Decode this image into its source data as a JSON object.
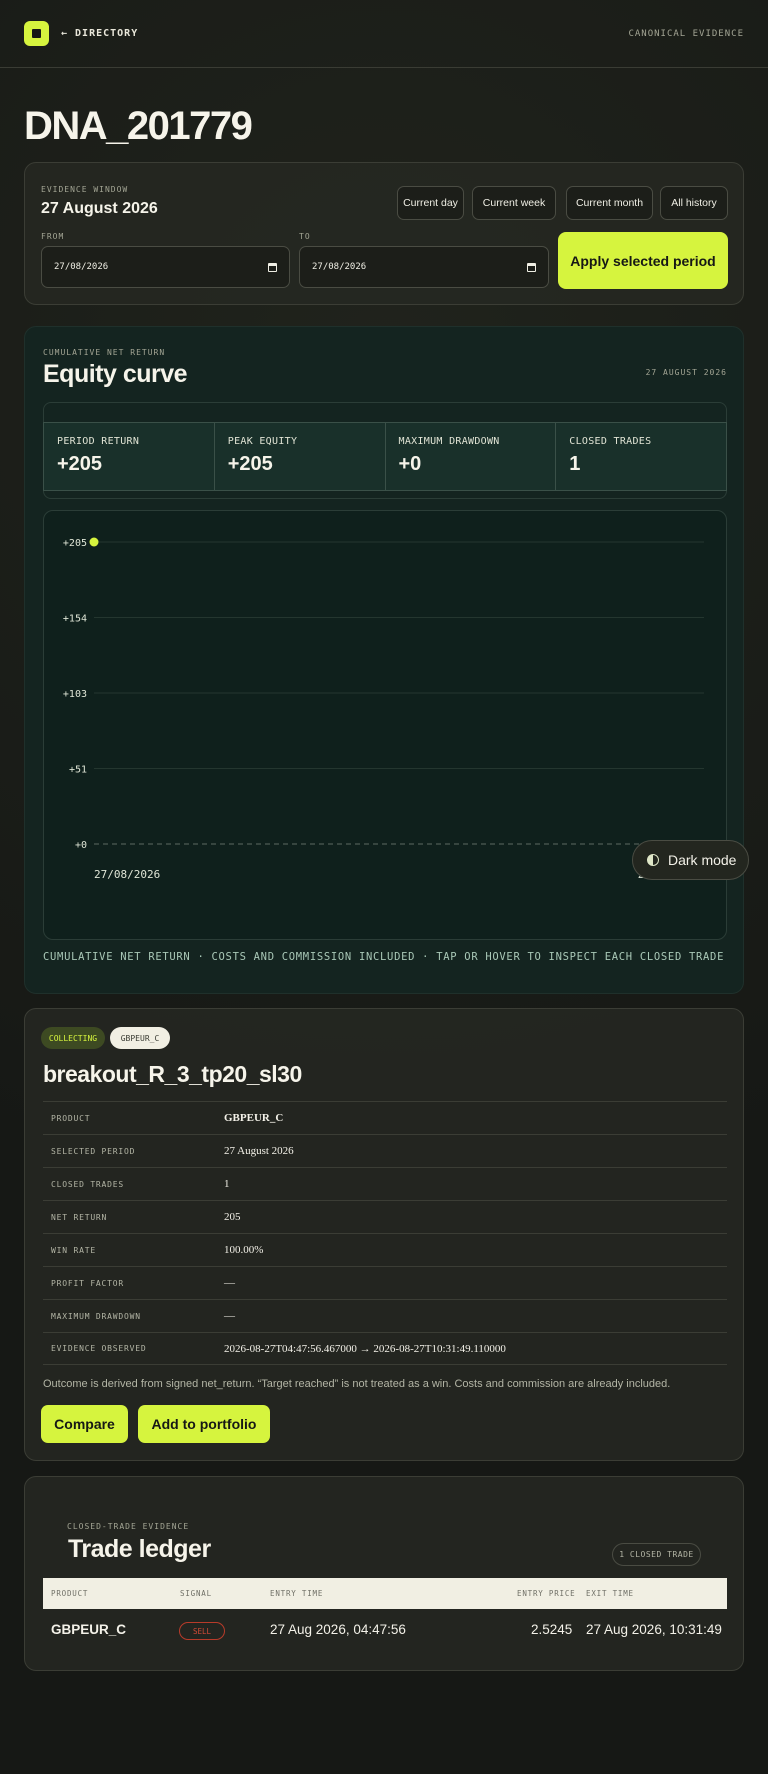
{
  "header": {
    "back_label": "← DIRECTORY",
    "right_label": "CANONICAL EVIDENCE"
  },
  "page": {
    "title": "DNA_201779"
  },
  "evidence_window": {
    "kicker": "EVIDENCE WINDOW",
    "date": "27 August 2026",
    "quick_ranges": [
      "Current day",
      "Current week",
      "Current month",
      "All history"
    ],
    "from_label": "FROM",
    "to_label": "TO",
    "from_value": "27/08/2026",
    "to_value": "27/08/2026",
    "apply_label": "Apply selected period"
  },
  "equity": {
    "kicker": "CUMULATIVE NET RETURN",
    "title": "Equity curve",
    "date": "27 AUGUST 2026",
    "stats": [
      {
        "label": "PERIOD RETURN",
        "value": "+205"
      },
      {
        "label": "PEAK EQUITY",
        "value": "+205"
      },
      {
        "label": "MAXIMUM DRAWDOWN",
        "value": "+0"
      },
      {
        "label": "CLOSED TRADES",
        "value": "1"
      }
    ],
    "caption": "CUMULATIVE NET RETURN · COSTS AND COMMISSION INCLUDED · TAP OR HOVER TO INSPECT EACH CLOSED TRADE"
  },
  "chart_data": {
    "type": "line",
    "x": [
      "27/08/2026"
    ],
    "series": [
      {
        "values": [
          205
        ]
      }
    ],
    "yticks": [
      "+205",
      "+154",
      "+103",
      "+51",
      "+0"
    ],
    "xticks": [
      "27/08/2026",
      "27/08/2026"
    ],
    "ylim": [
      0,
      205
    ],
    "baseline": 0,
    "colors": {
      "point": "#d6f43e",
      "grid": "#24362f",
      "baseline": "#5c6a62"
    }
  },
  "dark_mode_label": "Dark mode",
  "strategy": {
    "status_badge": "COLLECTING",
    "product_badge": "GBPEUR_C",
    "name": "breakout_R_3_tp20_sl30",
    "details": [
      {
        "key": "PRODUCT",
        "value": "GBPEUR_C"
      },
      {
        "key": "SELECTED PERIOD",
        "value": "27 August 2026"
      },
      {
        "key": "CLOSED TRADES",
        "value": "1"
      },
      {
        "key": "NET RETURN",
        "value": "205"
      },
      {
        "key": "WIN RATE",
        "value": "100.00%"
      },
      {
        "key": "PROFIT FACTOR",
        "value": "—"
      },
      {
        "key": "MAXIMUM DRAWDOWN",
        "value": "—"
      },
      {
        "key": "EVIDENCE OBSERVED",
        "value": "2026-08-27T04:47:56.467000 → 2026-08-27T10:31:49.110000"
      }
    ],
    "note": "Outcome is derived from signed net_return. “Target reached” is not treated as a win. Costs and commission are already included.",
    "compare_label": "Compare",
    "portfolio_label": "Add to portfolio"
  },
  "ledger": {
    "kicker": "CLOSED-TRADE EVIDENCE",
    "title": "Trade ledger",
    "badge": "1 CLOSED TRADE",
    "columns": [
      "PRODUCT",
      "SIGNAL",
      "ENTRY TIME",
      "ENTRY PRICE",
      "EXIT TIME"
    ],
    "rows": [
      {
        "product": "GBPEUR_C",
        "signal": "SELL",
        "entry_time": "27 Aug 2026, 04:47:56",
        "entry_price": "2.5245",
        "exit_time": "27 Aug 2026, 10:31:49"
      }
    ]
  },
  "colors": {
    "accent": "#d6f43e",
    "background": "#161815",
    "sell": "#d24a36"
  }
}
